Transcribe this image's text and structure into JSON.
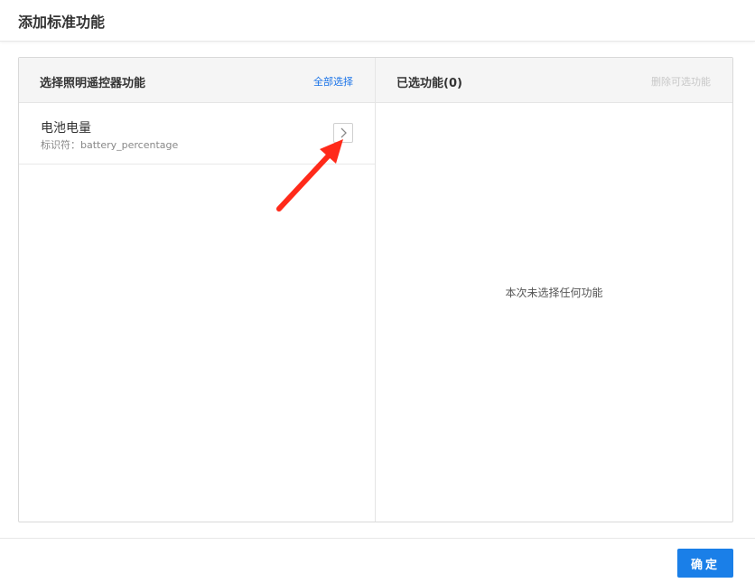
{
  "dialog": {
    "title": "添加标准功能"
  },
  "left_panel": {
    "title": "选择照明遥控器功能",
    "select_all_label": "全部选择",
    "items": [
      {
        "name": "电池电量",
        "identifier": "标识符：battery_percentage"
      }
    ]
  },
  "right_panel": {
    "title": "已选功能(0)",
    "remove_label": "删除可选功能",
    "empty_text": "本次未选择任何功能"
  },
  "footer": {
    "confirm_label": "确定"
  },
  "colors": {
    "accent": "#1a7fe8",
    "annotation": "#ff2a1a"
  },
  "icons": {
    "item_action": "chevron-right-icon",
    "annotation": "red-arrow-annotation"
  }
}
